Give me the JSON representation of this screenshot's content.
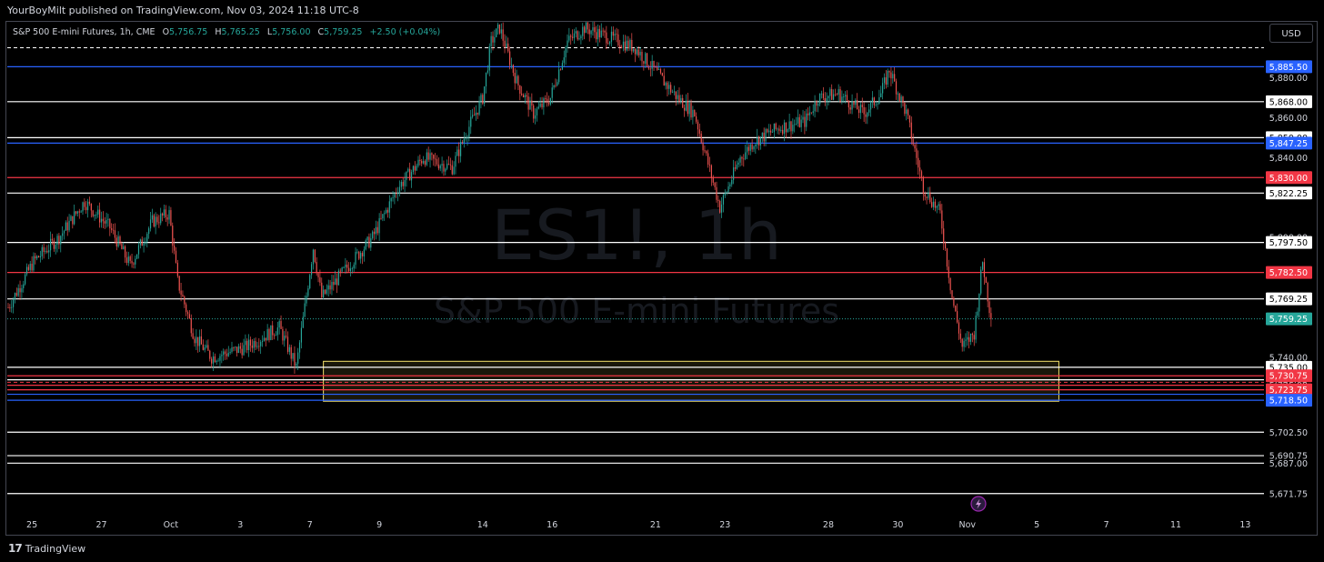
{
  "header": {
    "publisher_line": "YourBoyMilt published on TradingView.com, Nov 03, 2024 11:18 UTC-8"
  },
  "legend": {
    "symbol": "S&P 500 E-mini Futures, 1h, CME",
    "o_label": "O",
    "o_value": "5,756.75",
    "h_label": "H",
    "h_value": "5,765.25",
    "l_label": "L",
    "l_value": "5,756.00",
    "c_label": "C",
    "c_value": "5,759.25",
    "change": "+2.50 (+0.04%)"
  },
  "watermark": {
    "ticker": "ES1!, 1h",
    "name": "S&P 500 E-mini Futures"
  },
  "currency_button": "USD",
  "footer": {
    "brand": "TradingView"
  },
  "colors": {
    "up": "#26a69a",
    "down": "#ef5350",
    "blue_level": "#2962ff",
    "red_level": "#f23645",
    "white_level": "#ffffff",
    "zone": "#f5e26a"
  },
  "chart_data": {
    "type": "candlestick",
    "title": "S&P 500 E-mini Futures, 1h, CME",
    "ylim": [
      5663,
      5908
    ],
    "x_ticks": [
      {
        "label": "25",
        "bar": 14
      },
      {
        "label": "27",
        "bar": 55
      },
      {
        "label": "Oct",
        "bar": 96
      },
      {
        "label": "3",
        "bar": 137
      },
      {
        "label": "7",
        "bar": 178
      },
      {
        "label": "9",
        "bar": 219
      },
      {
        "label": "14",
        "bar": 280
      },
      {
        "label": "16",
        "bar": 321
      },
      {
        "label": "21",
        "bar": 382
      },
      {
        "label": "23",
        "bar": 423
      },
      {
        "label": "28",
        "bar": 484
      },
      {
        "label": "30",
        "bar": 525
      },
      {
        "label": "Nov",
        "bar": 566
      },
      {
        "label": "5",
        "bar": 607
      },
      {
        "label": "7",
        "bar": 648
      },
      {
        "label": "11",
        "bar": 689
      },
      {
        "label": "13",
        "bar": 730
      }
    ],
    "y_ticks": [
      "5,880.00",
      "5,860.00",
      "5,840.00",
      "5,800.00",
      "5,740.00",
      "5,730.00",
      "5,728.75",
      "5,726.00",
      "5,721.50",
      "5,702.50",
      "5,690.75",
      "5,687.00",
      "5,671.75"
    ],
    "y_tick_values": [
      5880,
      5860,
      5840,
      5800,
      5740,
      5730,
      5728.75,
      5726,
      5721.5,
      5702.5,
      5690.75,
      5687,
      5671.75
    ],
    "price_path": {
      "key_bars": [
        0,
        15,
        30,
        45,
        60,
        72,
        85,
        95,
        100,
        110,
        120,
        140,
        160,
        170,
        180,
        185,
        200,
        215,
        230,
        245,
        262,
        270,
        280,
        285,
        290,
        300,
        310,
        320,
        330,
        340,
        355,
        370,
        385,
        395,
        405,
        420,
        432,
        440,
        455,
        470,
        478,
        490,
        505,
        515,
        520,
        530,
        540,
        550,
        557,
        563,
        570,
        575,
        580
      ],
      "key_values": [
        5765,
        5788,
        5800,
        5818,
        5805,
        5786,
        5808,
        5812,
        5778,
        5750,
        5740,
        5745,
        5755,
        5735,
        5795,
        5770,
        5785,
        5800,
        5825,
        5840,
        5835,
        5852,
        5870,
        5898,
        5905,
        5878,
        5862,
        5870,
        5898,
        5905,
        5900,
        5895,
        5880,
        5870,
        5862,
        5815,
        5840,
        5848,
        5855,
        5858,
        5870,
        5872,
        5862,
        5872,
        5884,
        5862,
        5825,
        5812,
        5770,
        5745,
        5752,
        5788,
        5759
      ]
    },
    "levels": [
      {
        "value": 5885.5,
        "label": "5,885.50",
        "color": "blue",
        "tagged": true
      },
      {
        "value": 5868.0,
        "label": "5,868.00",
        "color": "white",
        "tagged": true
      },
      {
        "value": 5850.0,
        "label": "5,850.00",
        "color": "white",
        "tagged": true
      },
      {
        "value": 5847.25,
        "label": "5,847.25",
        "color": "blue",
        "tagged": true
      },
      {
        "value": 5830.0,
        "label": "5,830.00",
        "color": "red",
        "tagged": true
      },
      {
        "value": 5822.25,
        "label": "5,822.25",
        "color": "white",
        "tagged": true
      },
      {
        "value": 5797.5,
        "label": "5,797.50",
        "color": "white",
        "tagged": true
      },
      {
        "value": 5782.5,
        "label": "5,782.50",
        "color": "red",
        "tagged": true
      },
      {
        "value": 5769.25,
        "label": "5,769.25",
        "color": "white",
        "tagged": true
      },
      {
        "value": 5735.0,
        "label": "5,735.00",
        "color": "white",
        "tagged": true
      },
      {
        "value": 5730.75,
        "label": "5,730.75",
        "color": "red",
        "tagged": true
      },
      {
        "value": 5728.75,
        "label": "",
        "color": "white",
        "tagged": false
      },
      {
        "value": 5726.0,
        "label": "",
        "color": "red",
        "tagged": false
      },
      {
        "value": 5721.5,
        "label": "",
        "color": "blue",
        "tagged": false
      },
      {
        "value": 5723.75,
        "label": "5,723.75",
        "color": "red",
        "tagged": true
      },
      {
        "value": 5718.5,
        "label": "5,718.50",
        "color": "blue",
        "tagged": true
      },
      {
        "value": 5702.5,
        "label": "",
        "color": "white",
        "tagged": false
      },
      {
        "value": 5690.75,
        "label": "",
        "color": "white",
        "tagged": false
      },
      {
        "value": 5687.0,
        "label": "",
        "color": "white",
        "tagged": false
      },
      {
        "value": 5671.75,
        "label": "",
        "color": "white",
        "tagged": false
      }
    ],
    "top_dashed_level": 5895,
    "last_price": {
      "value": 5759.25,
      "label": "5,759.25"
    },
    "zone": {
      "from_bar": 186,
      "to_bar": 620,
      "high": 5738,
      "low": 5718
    }
  }
}
